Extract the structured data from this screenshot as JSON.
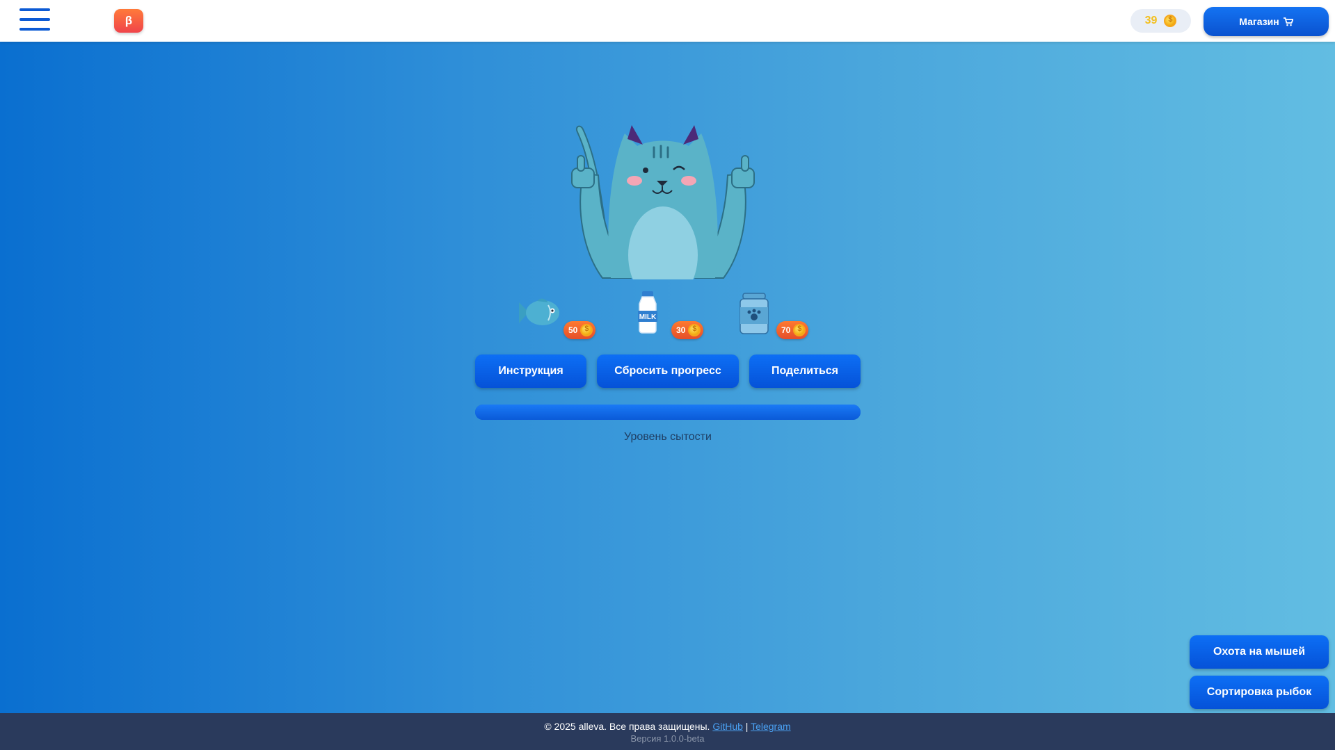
{
  "header": {
    "beta_label": "β",
    "coins": "39",
    "shop_label": "Магазин"
  },
  "foods": [
    {
      "name": "fish",
      "price": "50"
    },
    {
      "name": "milk",
      "price": "30",
      "text": "MILK"
    },
    {
      "name": "cat-food",
      "price": "70"
    }
  ],
  "actions": {
    "instructions": "Инструкция",
    "reset": "Сбросить прогресс",
    "share": "Поделиться"
  },
  "satiety": {
    "label": "Уровень сытости",
    "level": 1.0
  },
  "side": {
    "hunt": "Охота на мышей",
    "sort": "Сортировка рыбок"
  },
  "footer": {
    "copyright": "© 2025 alleva. Все права защищены.",
    "github": "GitHub",
    "separator": "|",
    "telegram": "Telegram",
    "version": "Версия 1.0.0-beta"
  },
  "colors": {
    "accent": "#0a5ad8",
    "badge": "#e54e2a",
    "coin": "#f3bf1d"
  },
  "icons": [
    "menu-icon",
    "cart-icon",
    "coin-icon",
    "cat-illustration",
    "fish-icon",
    "milk-bottle-icon",
    "cat-food-jar-icon"
  ]
}
